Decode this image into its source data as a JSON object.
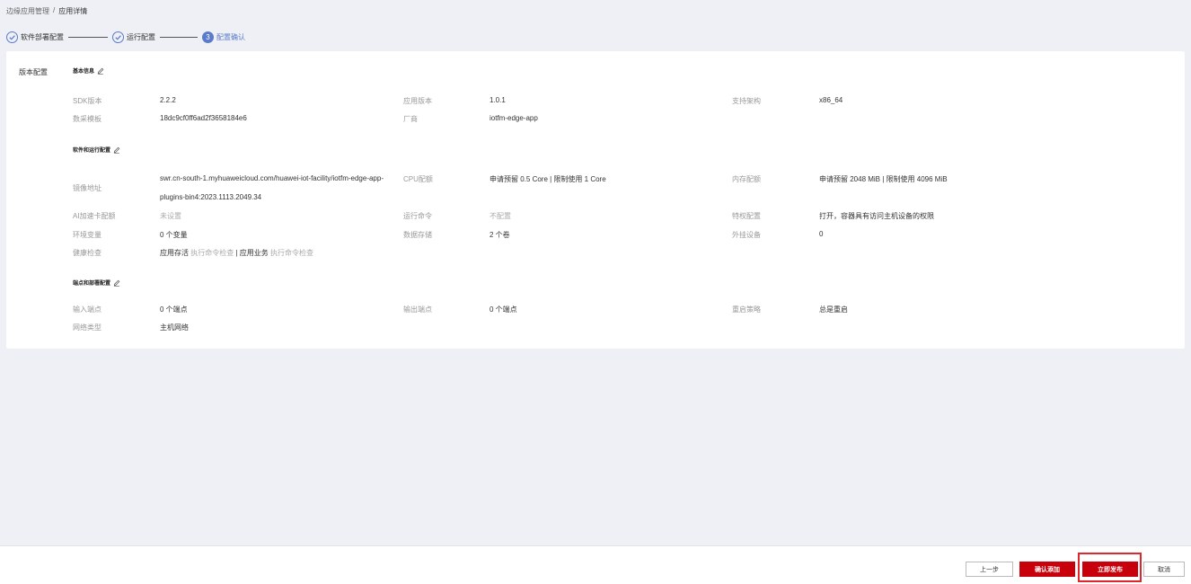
{
  "breadcrumb": {
    "parent": "边缘应用管理",
    "separator": "/",
    "current": "应用详情"
  },
  "steps": [
    {
      "label": "软件部署配置",
      "status": "done"
    },
    {
      "label": "运行配置",
      "status": "done"
    },
    {
      "number": "3",
      "label": "配置确认",
      "status": "current"
    }
  ],
  "side_label": "版本配置",
  "sections": {
    "basic": {
      "title": "基本信息",
      "sdk_label": "SDK版本",
      "sdk_value": "2.2.2",
      "app_version_label": "应用版本",
      "app_version_value": "1.0.1",
      "arch_label": "支持架构",
      "arch_value": "x86_64",
      "template_label": "数采模板",
      "template_value": "18dc9cf0ff6ad2f3658184e6",
      "vendor_label": "厂商",
      "vendor_value": "iotfm-edge-app"
    },
    "runtime": {
      "title": "软件和运行配置",
      "image_label": "镜像地址",
      "image_value": "swr.cn-south-1.myhuaweicloud.com/huawei-iot-facility/iotfm-edge-app-plugins-bin4:2023.1113.2049.34",
      "cpu_label": "CPU配额",
      "cpu_value": "申请预留 0.5 Core | 限制使用 1 Core",
      "memory_label": "内存配额",
      "memory_value": "申请预留 2048 MiB | 限制使用 4096 MiB",
      "ai_label": "AI加速卡配额",
      "ai_value": "未设置",
      "command_label": "运行命令",
      "command_value": "不配置",
      "privilege_label": "特权配置",
      "privilege_value": "打开，容器具有访问主机设备的权限",
      "env_label": "环境变量",
      "env_value": "0 个变量",
      "storage_label": "数据存储",
      "storage_value": "2 个卷",
      "device_label": "外挂设备",
      "device_value": "0",
      "health_label": "健康检查",
      "health_liveness": "应用存活",
      "health_liveness_cmd": "执行命令检查",
      "health_separator": "|",
      "health_readiness": "应用业务",
      "health_readiness_cmd": "执行命令检查"
    },
    "endpoint": {
      "title": "端点和部署配置",
      "input_label": "输入端点",
      "input_value": "0 个端点",
      "output_label": "输出端点",
      "output_value": "0 个端点",
      "restart_label": "重启策略",
      "restart_value": "总是重启",
      "network_label": "网络类型",
      "network_value": "主机网络"
    }
  },
  "footer": {
    "prev_label": "上一步",
    "confirm_add_label": "确认添加",
    "publish_label": "立即发布",
    "cancel_label": "取消"
  },
  "colors": {
    "accent": "#5a7bc8",
    "primary_button": "#c7000b",
    "highlight": "#e0262b"
  }
}
